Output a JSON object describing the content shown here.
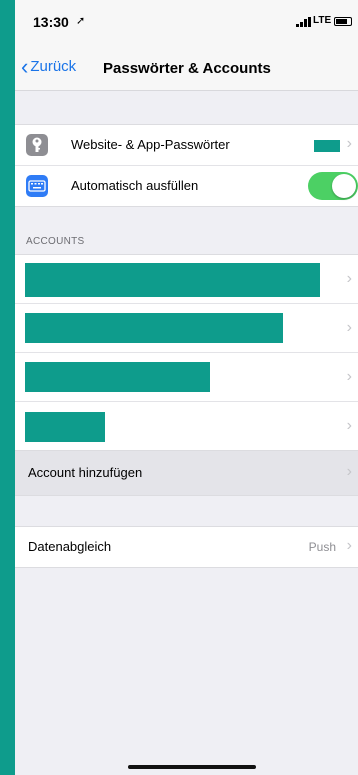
{
  "status": {
    "time": "13:30",
    "network": "LTE"
  },
  "nav": {
    "back_label": "Zurück",
    "title": "Passwörter & Accounts"
  },
  "settings": {
    "passwords_label": "Website- & App-Passwörter",
    "autofill_label": "Automatisch ausfüllen",
    "autofill_enabled": true
  },
  "accounts": {
    "section_header": "ACCOUNTS",
    "redacted_rows": 4,
    "add_label": "Account hinzufügen"
  },
  "sync": {
    "label": "Datenabgleich",
    "value": "Push"
  },
  "colors": {
    "accent": "#1a74e8",
    "toggle_on": "#4cd064",
    "redaction": "#0e9c8c"
  }
}
